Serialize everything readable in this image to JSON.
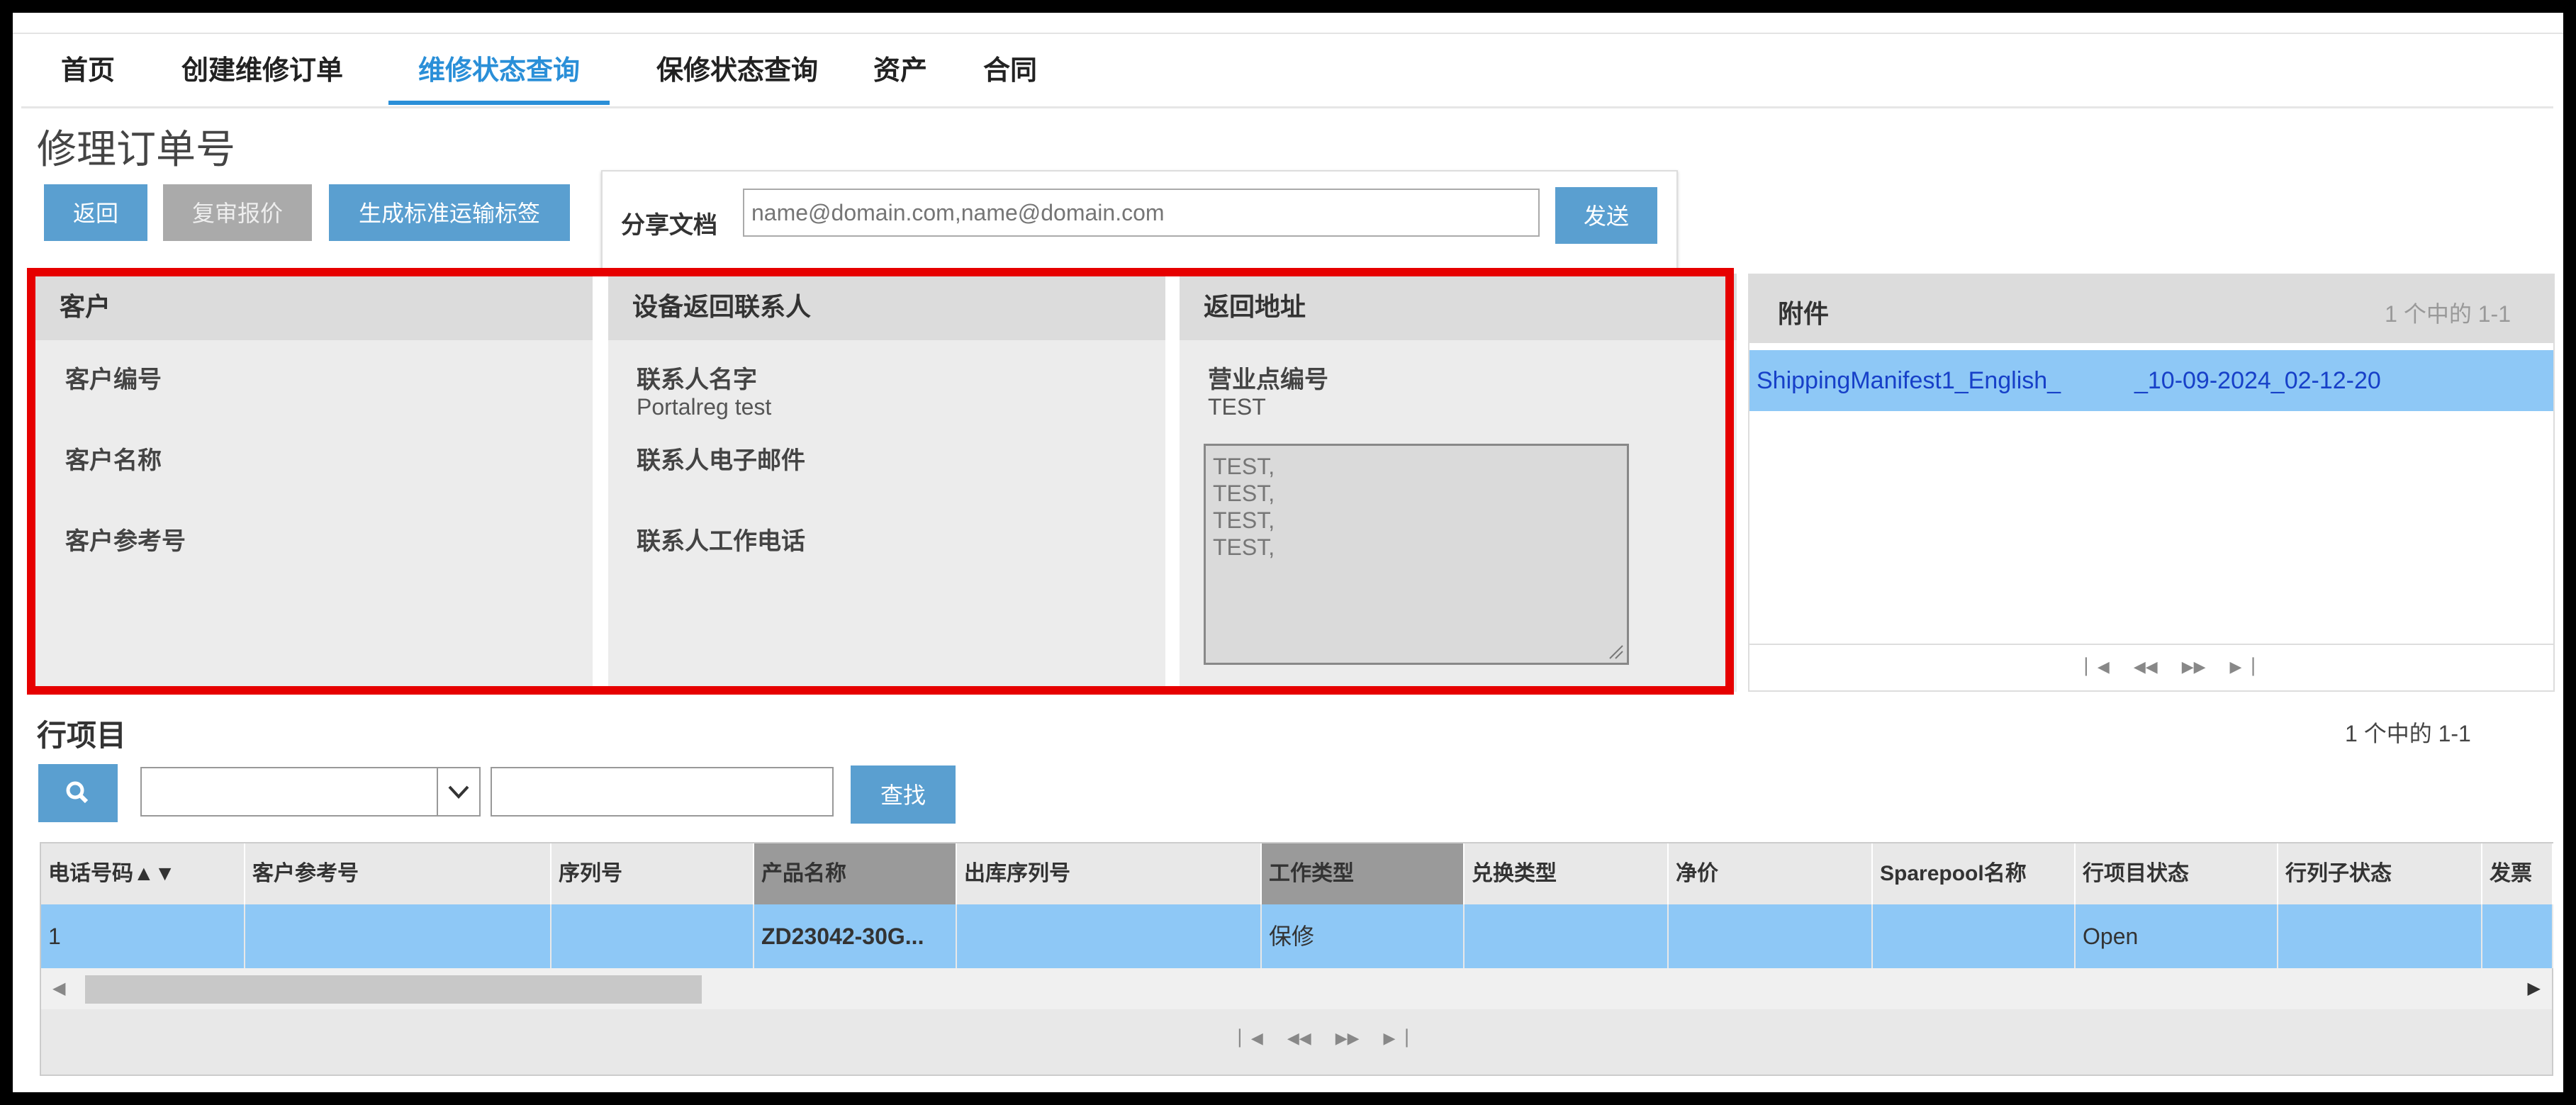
{
  "nav": {
    "tabs": [
      "首页",
      "创建维修订单",
      "维修状态查询",
      "保修状态查询",
      "资产",
      "合同"
    ],
    "active_index": 2
  },
  "page": {
    "title": "修理订单号"
  },
  "toolbar": {
    "back_label": "返回",
    "review_quote_label": "复审报价",
    "gen_label_label": "生成标准运输标签"
  },
  "share": {
    "label": "分享文档",
    "placeholder": "name@domain.com,name@domain.com",
    "send_label": "发送"
  },
  "customer_panel": {
    "title": "客户",
    "fields": [
      {
        "label": "客户编号",
        "value": ""
      },
      {
        "label": "客户名称",
        "value": ""
      },
      {
        "label": "客户参考号",
        "value": ""
      }
    ]
  },
  "contact_panel": {
    "title": "设备返回联系人",
    "fields": [
      {
        "label": "联系人名字",
        "value": "Portalreg test"
      },
      {
        "label": "联系人电子邮件",
        "value": ""
      },
      {
        "label": "联系人工作电话",
        "value": ""
      }
    ]
  },
  "return_panel": {
    "title": "返回地址",
    "branch_label": "营业点编号",
    "branch_value": "TEST",
    "address_lines": [
      "TEST,",
      "TEST,",
      "TEST,",
      "TEST,"
    ]
  },
  "attachments": {
    "title": "附件",
    "count_text": "1 个中的 1-1",
    "items": [
      {
        "name": "ShippingManifest1_English_           _10-09-2024_02-12-20"
      }
    ]
  },
  "line_items": {
    "title": "行项目",
    "count_text": "1 个中的 1-1",
    "find_label": "查找",
    "search_select_value": "",
    "search_text_value": "",
    "columns": [
      "电话号码▲▼",
      "客户参考号",
      "序列号",
      "产品名称",
      "出库序列号",
      "工作类型",
      "兑换类型",
      "净价",
      "Sparepool名称",
      "行项目状态",
      "行列子状态",
      "发票"
    ],
    "rows": [
      [
        "1",
        "",
        "",
        "ZD23042-30G...",
        "",
        "保修",
        "",
        "",
        "",
        "Open",
        "",
        ""
      ]
    ]
  },
  "colors": {
    "accent": "#2a8fd8",
    "button": "#5a9fd0",
    "highlight": "#e60000",
    "selected_row": "#8ec8f6"
  }
}
